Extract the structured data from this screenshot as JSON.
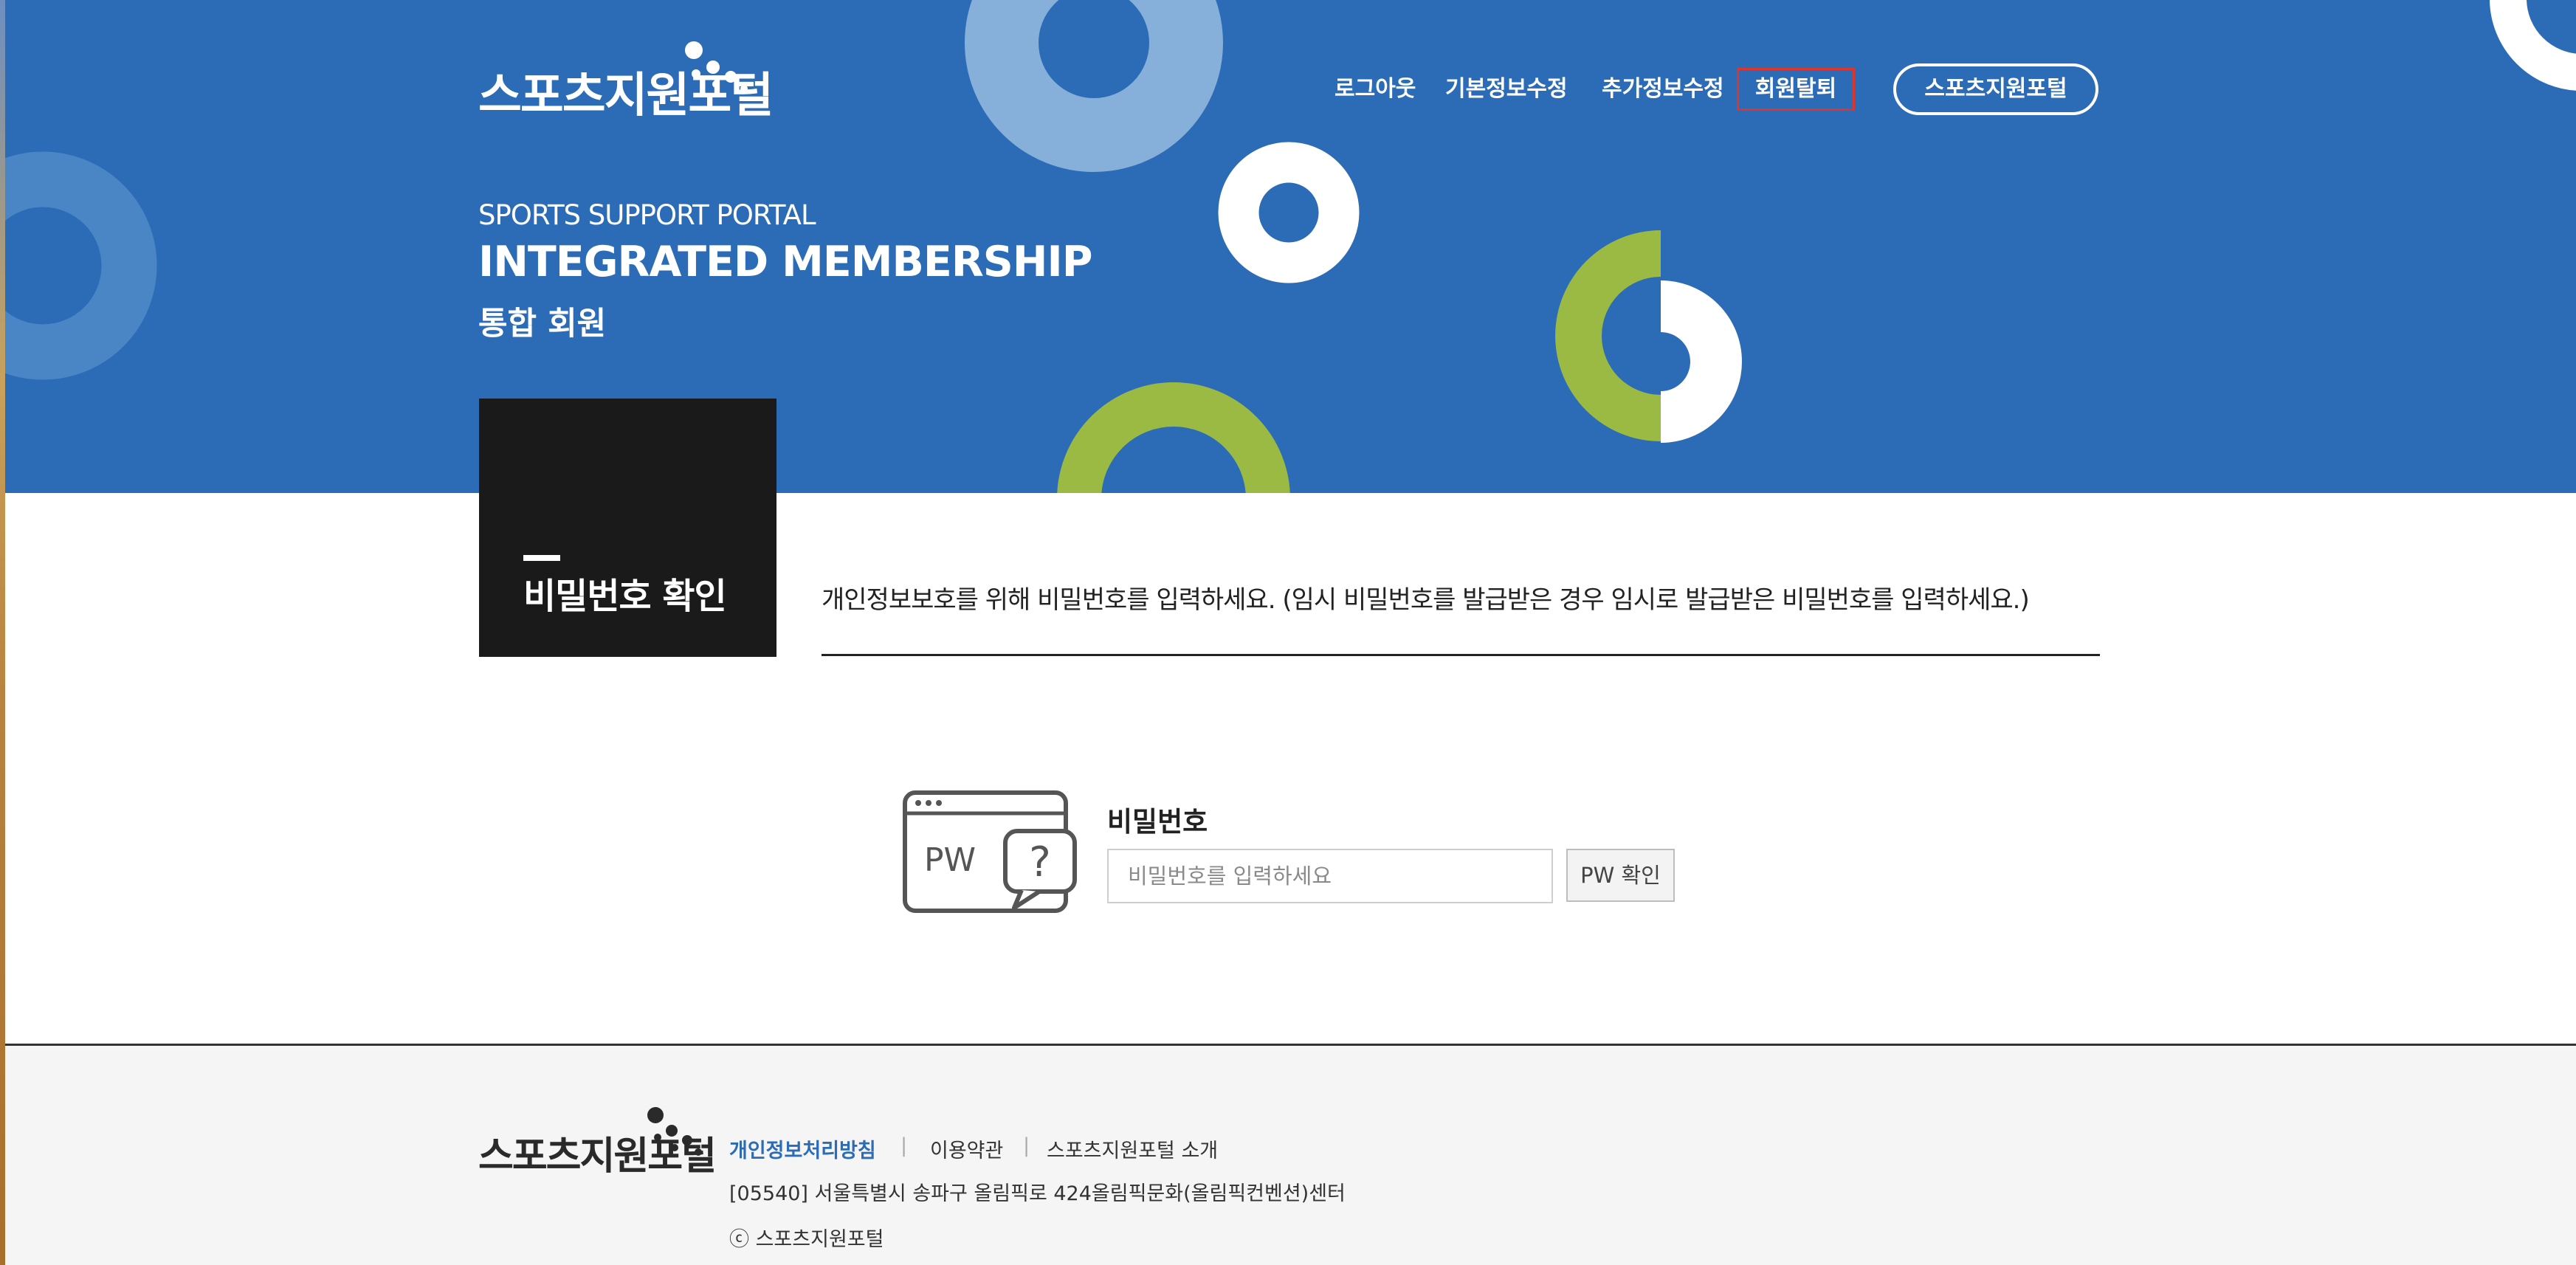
{
  "colors": {
    "hero_bg": "#2c6cb7",
    "ring_light": "#86b0d9",
    "ring_mid": "#4a86c6",
    "ring_green": "#9bba44",
    "tile_bg": "#1a1a1a",
    "withdraw_highlight": "#e0332c",
    "footer_bg": "#f5f5f5",
    "privacy_link": "#2c6cb7"
  },
  "header": {
    "logo_text": "스포츠지원포털",
    "nav": {
      "logout": "로그아웃",
      "basic_info": "기본정보수정",
      "extra_info": "추가정보수정",
      "withdraw": "회원탈퇴"
    },
    "portal_button": "스포츠지원포털"
  },
  "hero": {
    "eyebrow": "SPORTS SUPPORT PORTAL",
    "title": "INTEGRATED MEMBERSHIP",
    "subtitle": "통합 회원"
  },
  "section": {
    "title": "비밀번호 확인",
    "notice": "개인정보보호를 위해 비밀번호를 입력하세요. (임시 비밀번호를 발급받은 경우 임시로 발급받은 비밀번호를 입력하세요.)"
  },
  "password_form": {
    "icon": "pw-question-icon",
    "icon_text": "PW",
    "label": "비밀번호",
    "placeholder": "비밀번호를 입력하세요",
    "value": "",
    "confirm_button": "PW 확인"
  },
  "footer": {
    "logo_text": "스포츠지원포털",
    "links": {
      "privacy": "개인정보처리방침",
      "terms": "이용약관",
      "about": "스포츠지원포털 소개"
    },
    "separator": "|",
    "address": "[05540] 서울특별시 송파구 올림픽로 424올림픽문화(올림픽컨벤션)센터",
    "copyright": "ⓒ 스포츠지원포털"
  }
}
